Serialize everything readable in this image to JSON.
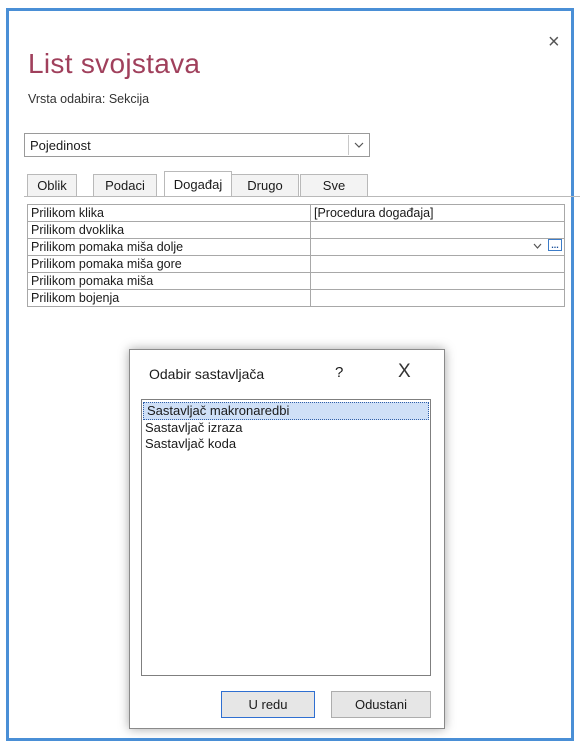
{
  "panel": {
    "title": "List svojstava",
    "selection_type": "Vrsta odabira:  Sekcija",
    "close_glyph": "×"
  },
  "object_select": {
    "value": "Pojedinost"
  },
  "tabs": [
    {
      "label": "Oblik",
      "active": false
    },
    {
      "label": "Podaci",
      "active": false
    },
    {
      "label": "Događaj",
      "active": true
    },
    {
      "label": "Drugo",
      "active": false
    },
    {
      "label": "Sve",
      "active": false
    }
  ],
  "properties": [
    {
      "name": "Prilikom klika",
      "value": "[Procedura događaja]"
    },
    {
      "name": "Prilikom dvoklika",
      "value": ""
    },
    {
      "name": "Prilikom pomaka miša dolje",
      "value": ""
    },
    {
      "name": "Prilikom pomaka miša gore",
      "value": ""
    },
    {
      "name": "Prilikom pomaka miša",
      "value": ""
    },
    {
      "name": "Prilikom bojenja",
      "value": ""
    }
  ],
  "builder_button": {
    "label": "..."
  },
  "dialog": {
    "title": "Odabir sastavljača",
    "help_glyph": "?",
    "close_glyph": "X",
    "items": [
      {
        "label": "Sastavljač makronaredbi",
        "selected": true
      },
      {
        "label": "Sastavljač izraza",
        "selected": false
      },
      {
        "label": "Sastavljač koda",
        "selected": false
      }
    ],
    "ok_label": "U redu",
    "cancel_label": "Odustani"
  },
  "colors": {
    "frame_border": "#4a8fd6",
    "title": "#a0405c",
    "selection_highlight": "#cfe0f7"
  }
}
